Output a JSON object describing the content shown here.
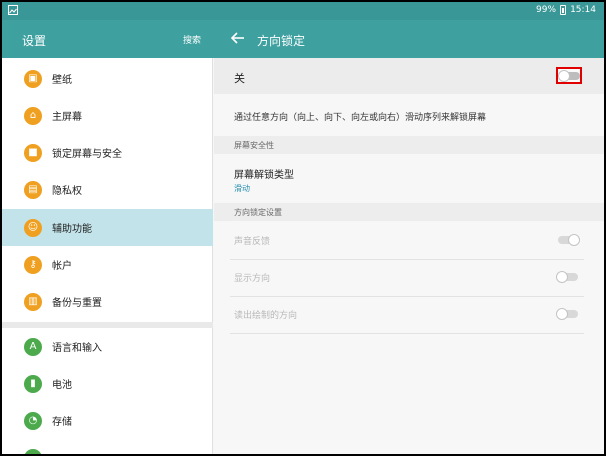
{
  "status_bar": {
    "battery_percent": "99%",
    "time": "15:14"
  },
  "header": {
    "left_title": "设置",
    "search_label": "搜索",
    "right_title": "方向锁定"
  },
  "sidebar": {
    "items": [
      {
        "label": "壁纸",
        "icon": "wallpaper-icon",
        "color": "#f0a020"
      },
      {
        "label": "主屏幕",
        "icon": "home-icon",
        "color": "#f0a020"
      },
      {
        "label": "锁定屏幕与安全",
        "icon": "lock-icon",
        "color": "#f0a020"
      },
      {
        "label": "隐私权",
        "icon": "privacy-icon",
        "color": "#f0a020"
      },
      {
        "label": "辅助功能",
        "icon": "accessibility-icon",
        "color": "#f0a020",
        "active": true
      },
      {
        "label": "帐户",
        "icon": "key-icon",
        "color": "#f0a020"
      },
      {
        "label": "备份与重置",
        "icon": "backup-icon",
        "color": "#f0a020"
      },
      {
        "label": "语言和输入",
        "icon": "language-icon",
        "color": "#4caa4c"
      },
      {
        "label": "电池",
        "icon": "battery-icon",
        "color": "#4caa4c"
      },
      {
        "label": "存储",
        "icon": "storage-icon",
        "color": "#4caa4c"
      }
    ]
  },
  "main": {
    "master_toggle_label": "关",
    "master_toggle_on": false,
    "description": "通过任意方向（向上、向下、向左或向右）滑动序列来解锁屏幕",
    "section_security": "屏幕安全性",
    "unlock_type_title": "屏幕解锁类型",
    "unlock_type_value": "滑动",
    "section_settings": "方向锁定设置",
    "settings": [
      {
        "label": "声音反馈",
        "on": true
      },
      {
        "label": "显示方向",
        "on": false
      },
      {
        "label": "读出绘制的方向",
        "on": false
      }
    ]
  },
  "colors": {
    "accent": "#3fa0a0",
    "active_item": "#c2e3e9",
    "highlight": "#e00000"
  }
}
